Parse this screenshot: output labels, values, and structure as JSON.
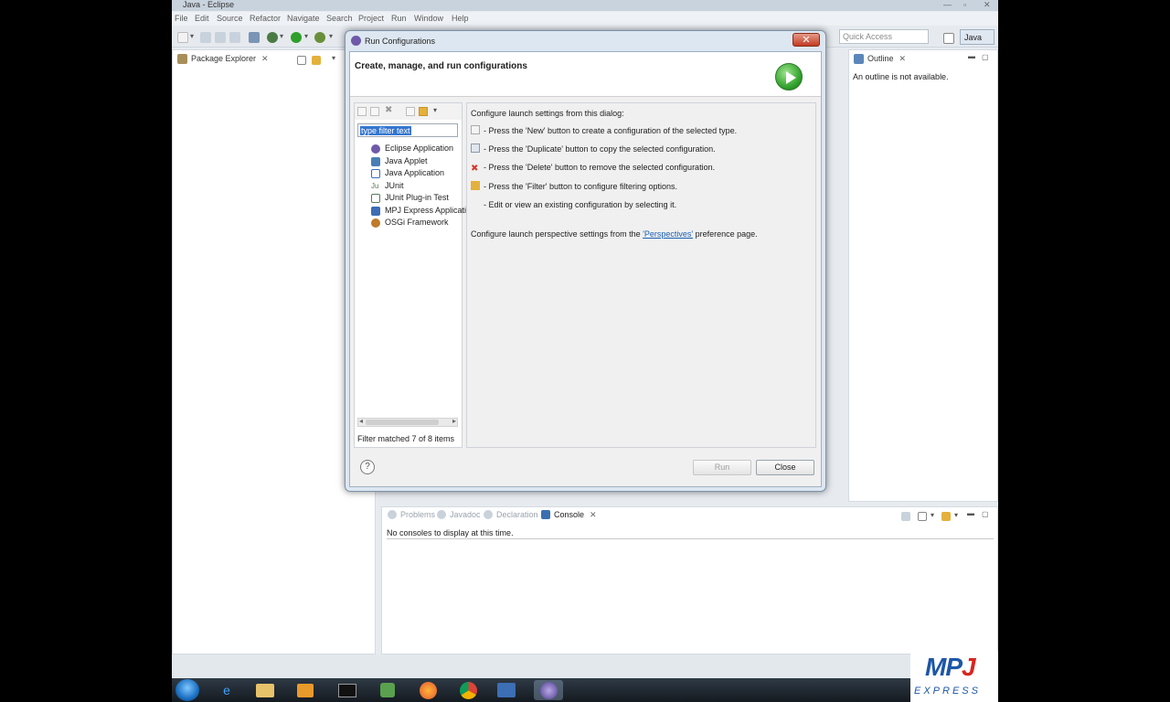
{
  "window": {
    "title": "Java - Eclipse"
  },
  "menu": [
    "File",
    "Edit",
    "Source",
    "Refactor",
    "Navigate",
    "Search",
    "Project",
    "Run",
    "Window",
    "Help"
  ],
  "toolbar": {
    "quick_access_placeholder": "Quick Access",
    "perspective_label": "Java"
  },
  "package_explorer": {
    "tab_label": "Package Explorer",
    "close_glyph": "✕"
  },
  "outline": {
    "tab_label": "Outline",
    "close_glyph": "✕",
    "message": "An outline is not available."
  },
  "bottom_panel": {
    "tabs": [
      {
        "label": "Problems",
        "active": false
      },
      {
        "label": "Javadoc",
        "active": false
      },
      {
        "label": "Declaration",
        "active": false
      },
      {
        "label": "Console",
        "active": true
      }
    ],
    "close_glyph": "✕",
    "message": "No consoles to display at this time."
  },
  "dialog": {
    "title": "Run Configurations",
    "close_glyph": "✕",
    "header": "Create, manage, and run configurations",
    "filter_placeholder": "type filter text",
    "tree_items": [
      {
        "label": "Eclipse Application",
        "icon": "eclipse-icon",
        "color": "#6e5aa8"
      },
      {
        "label": "Java Applet",
        "icon": "applet-icon",
        "color": "#4a7fb5"
      },
      {
        "label": "Java Application",
        "icon": "java-app-icon",
        "color": "#3b6fb0"
      },
      {
        "label": "JUnit",
        "icon": "junit-icon",
        "color": "#5b7a5b"
      },
      {
        "label": "JUnit Plug-in Test",
        "icon": "junit-plugin-icon",
        "color": "#5b7a5b"
      },
      {
        "label": "MPJ Express Applicati",
        "icon": "mpj-icon",
        "color": "#3d6db5"
      },
      {
        "label": "OSGi Framework",
        "icon": "osgi-icon",
        "color": "#c07a2a"
      }
    ],
    "filter_status": "Filter matched 7 of 8 items",
    "instructions_title": "Configure launch settings from this dialog:",
    "instructions": [
      {
        "icon": "new-icon",
        "color": "#f4f4f4",
        "text": "- Press the 'New' button to create a configuration of the selected type."
      },
      {
        "icon": "duplicate-icon",
        "color": "#e0e6ee",
        "text": "- Press the 'Duplicate' button to copy the selected configuration."
      },
      {
        "icon": "delete-icon",
        "color": "#d63a2a",
        "text": "- Press the 'Delete' button to remove the selected configuration."
      },
      {
        "icon": "filter-icon",
        "color": "#e3b13c",
        "text": "- Press the 'Filter' button to configure filtering options."
      },
      {
        "icon": "",
        "color": "",
        "text": "- Edit or view an existing configuration by selecting it."
      }
    ],
    "perspective_before": "Configure launch perspective settings from the ",
    "perspective_link": "'Perspectives'",
    "perspective_after": " preference page.",
    "run_label": "Run",
    "close_label": "Close",
    "help_glyph": "?"
  },
  "logo": {
    "big_mp": "MP",
    "big_j": "J",
    "small": "EXPRESS"
  }
}
